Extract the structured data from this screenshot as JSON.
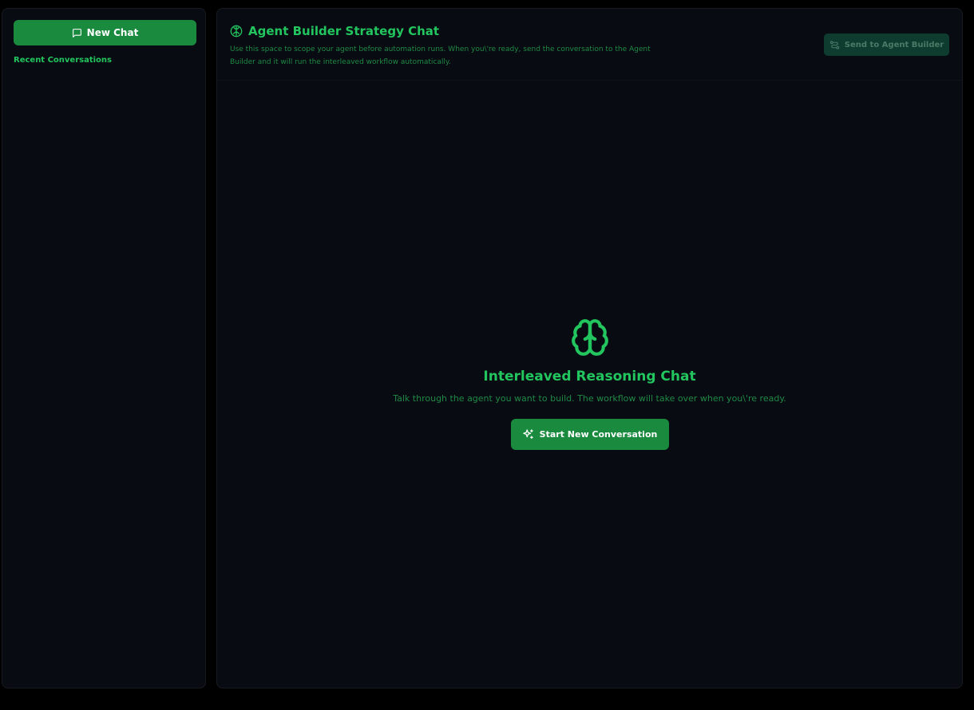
{
  "sidebar": {
    "new_chat_label": "New Chat",
    "new_chat_icon": "message-square-icon",
    "recent_label": "Recent Conversations"
  },
  "header": {
    "title": "Agent Builder Strategy Chat",
    "title_icon": "brain-icon",
    "subtitle": "Use this space to scope your agent before automation runs. When you\\'re ready, send the conversation to the Agent Builder and it will run the interleaved workflow automatically.",
    "send_label": "Send to Agent Builder",
    "send_icon": "workflow-icon",
    "send_disabled": true
  },
  "empty_state": {
    "icon": "brain-icon",
    "title": "Interleaved Reasoning Chat",
    "description": "Talk through the agent you want to build. The workflow will take over when you\\'re ready.",
    "start_label": "Start New Conversation",
    "start_icon": "sparkles-icon"
  },
  "colors": {
    "accent": "#22c55e",
    "button_bg": "#1a8a3f",
    "panel_bg": "#080b12",
    "page_bg": "#000000",
    "disabled_bg": "#0e3d30"
  }
}
